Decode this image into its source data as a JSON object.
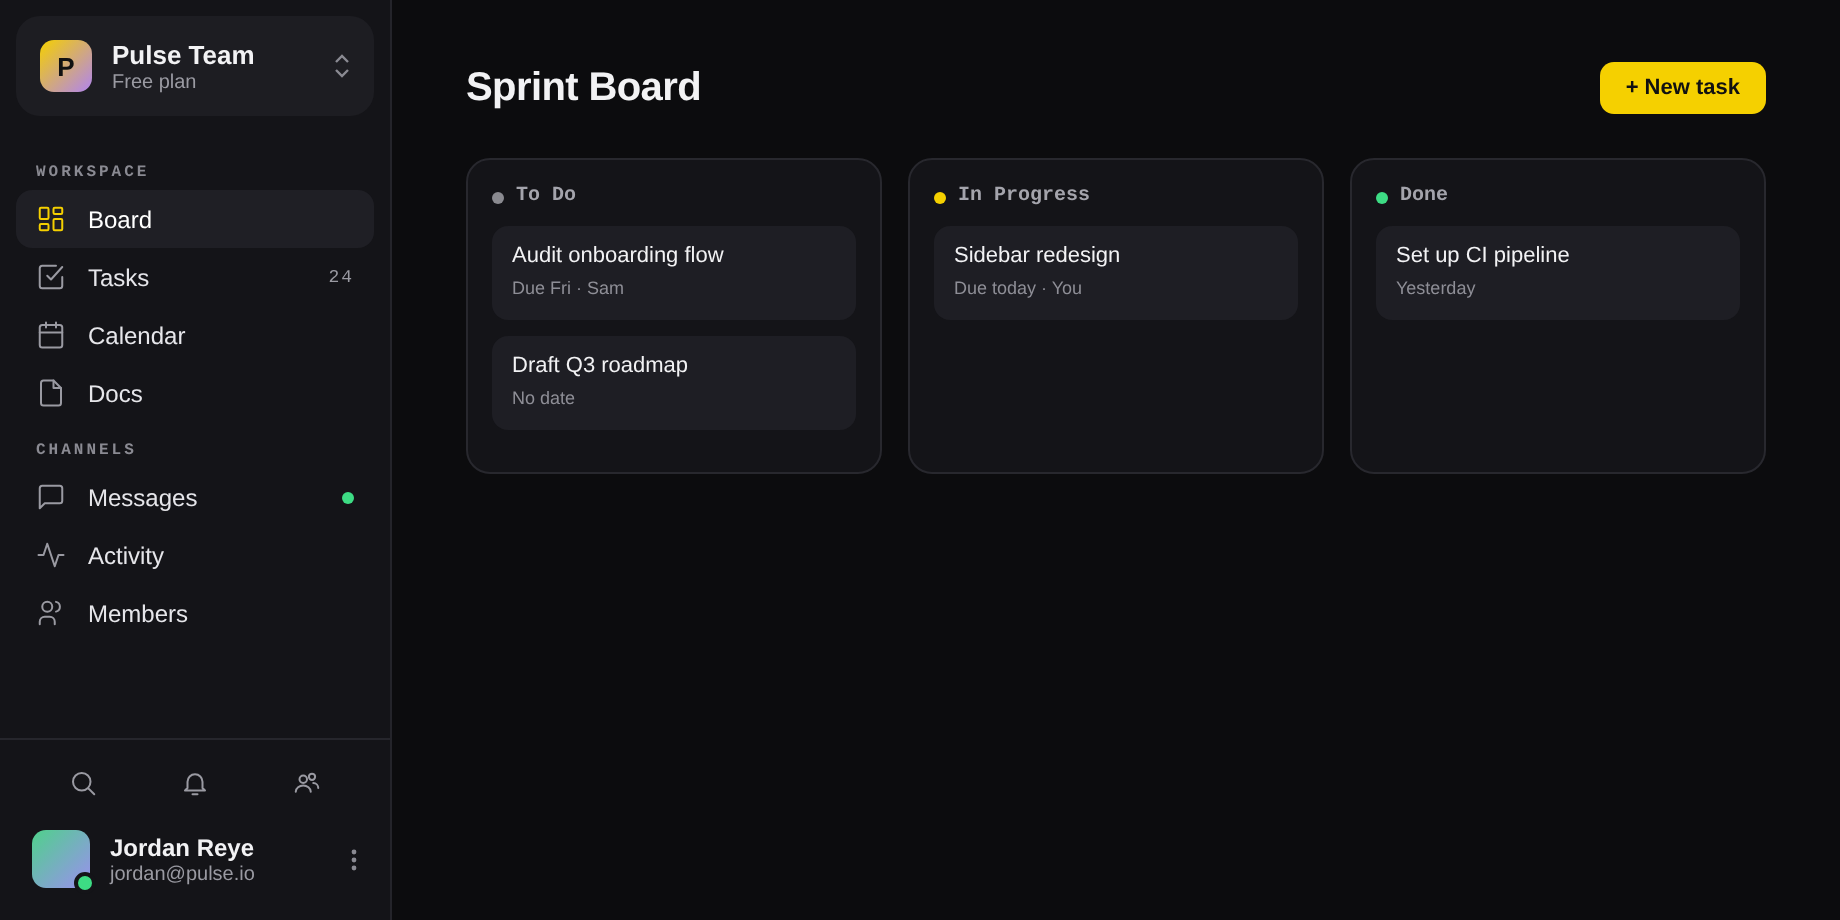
{
  "team": {
    "initial": "P",
    "name": "Pulse Team",
    "plan": "Free plan"
  },
  "sections": [
    {
      "title": "WORKSPACE",
      "items": [
        {
          "label": "Board",
          "selected": true
        },
        {
          "label": "Tasks",
          "selected": false,
          "count": "24"
        },
        {
          "label": "Calendar",
          "selected": false
        },
        {
          "label": "Docs",
          "selected": false
        }
      ]
    },
    {
      "title": "CHANNELS",
      "items": [
        {
          "label": "Messages",
          "selected": false,
          "unread": true
        },
        {
          "label": "Activity",
          "selected": false,
          "unread": false
        },
        {
          "label": "Members",
          "selected": false,
          "unread": false
        }
      ]
    }
  ],
  "user": {
    "name": "Jordan Reye",
    "email": "jordan@pulse.io",
    "online": true
  },
  "page_title": "Sprint Board",
  "new_button": "+ New task",
  "columns": [
    {
      "title": "To Do",
      "color": "#8a8a90",
      "cards": [
        {
          "title": "Audit onboarding flow",
          "meta": "Due Fri · Sam"
        },
        {
          "title": "Draft Q3 roadmap",
          "meta": "No date"
        }
      ]
    },
    {
      "title": "In Progress",
      "color": "#f5d000",
      "cards": [
        {
          "title": "Sidebar redesign",
          "meta": "Due today · You"
        }
      ]
    },
    {
      "title": "Done",
      "color": "#3ddc84",
      "cards": [
        {
          "title": "Set up CI pipeline",
          "meta": "Yesterday"
        }
      ]
    }
  ]
}
